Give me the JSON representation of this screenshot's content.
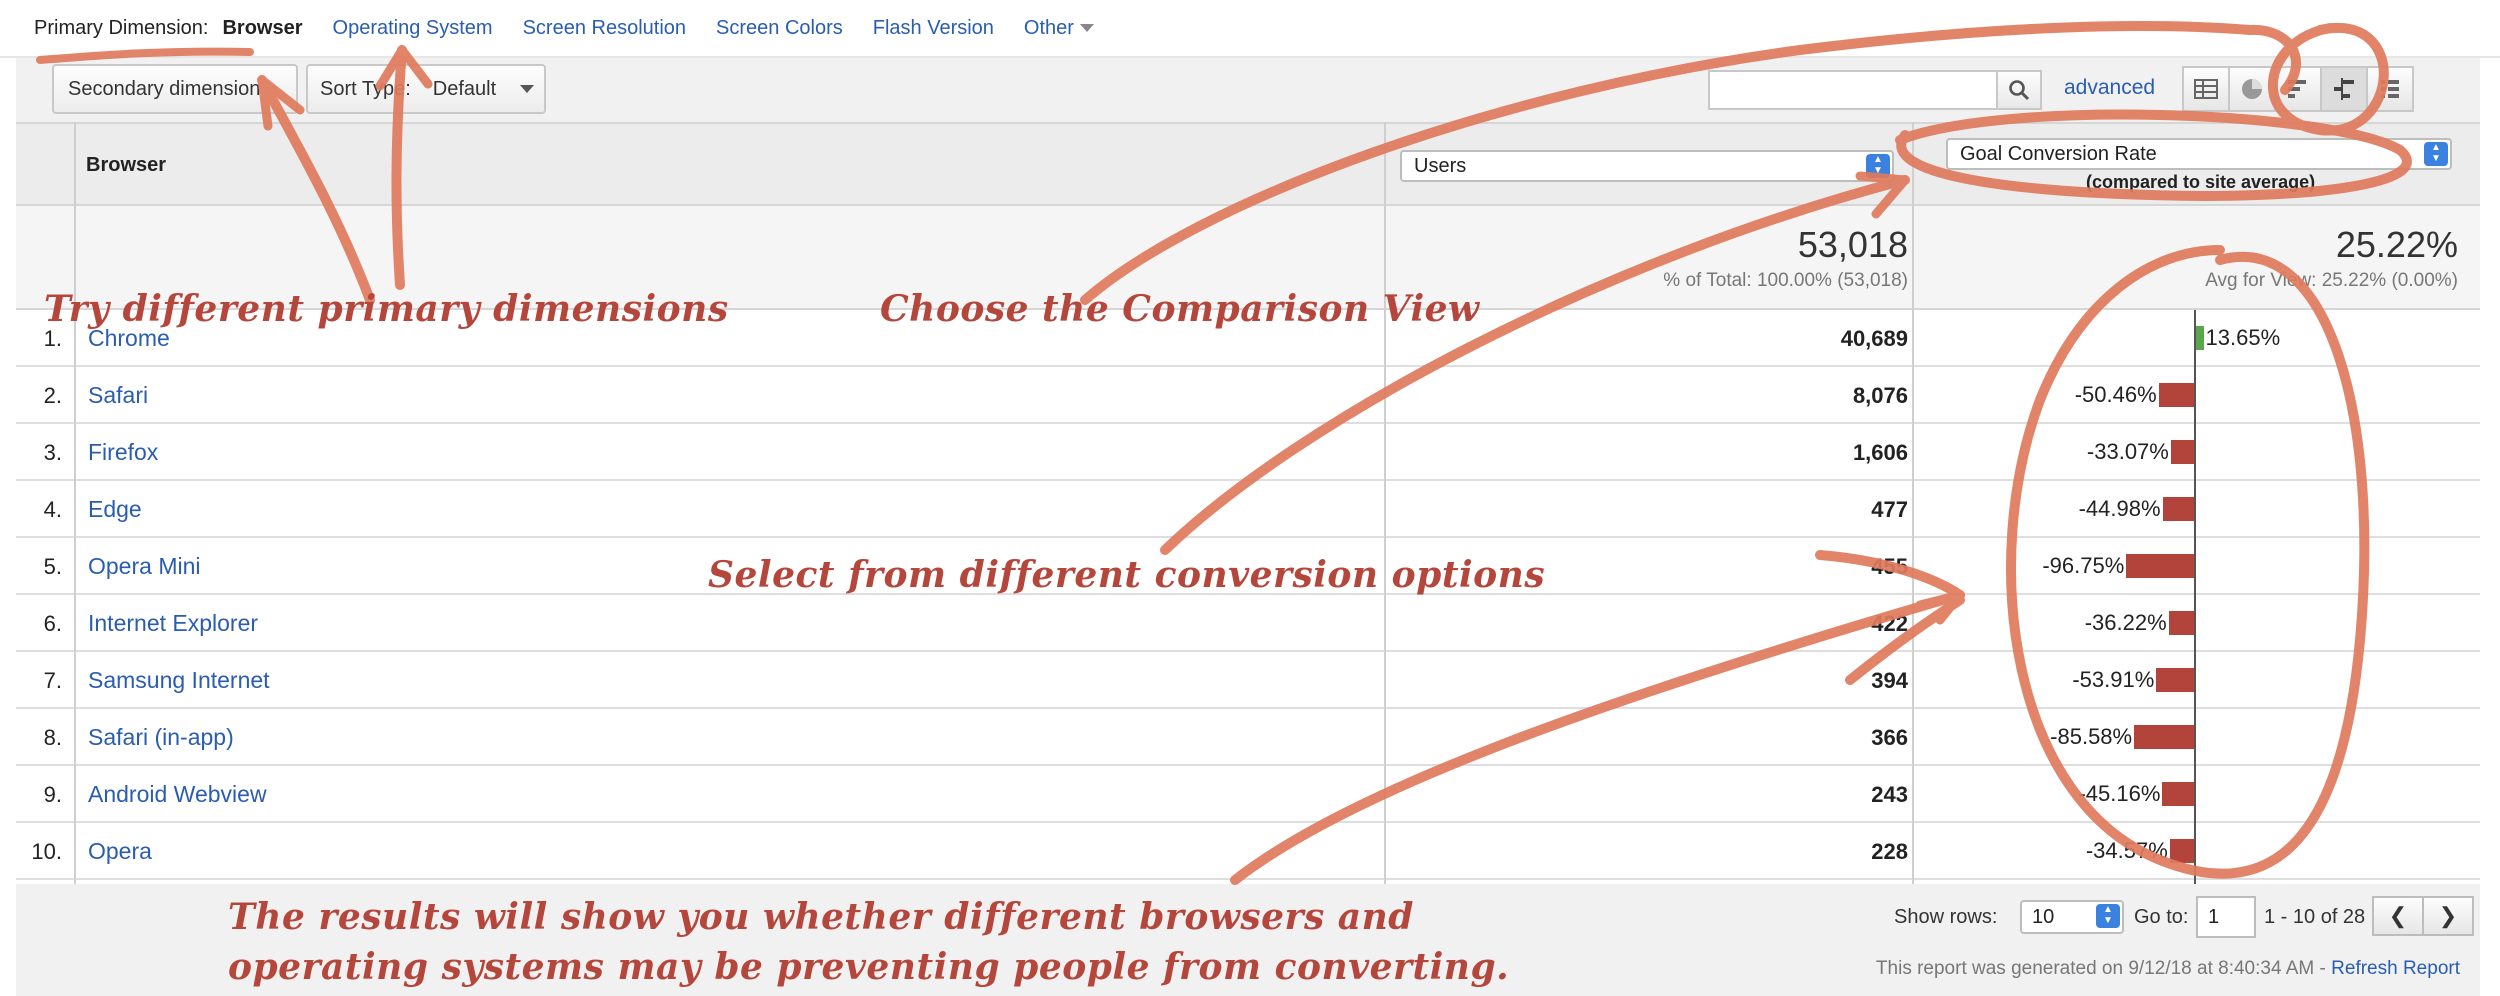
{
  "primary_dimension": {
    "label": "Primary Dimension:",
    "current": "Browser",
    "options": [
      "Operating System",
      "Screen Resolution",
      "Screen Colors",
      "Flash Version"
    ],
    "other": "Other"
  },
  "controls": {
    "secondary_dimension": "Secondary dimension",
    "sort_type_label": "Sort Type:",
    "sort_type_value": "Default",
    "search_placeholder": "",
    "advanced": "advanced"
  },
  "table": {
    "col_browser": "Browser",
    "metric_select": "Users",
    "comparison_select": "Goal Conversion Rate",
    "compared_note": "(compared to site average)",
    "totals": {
      "users": "53,018",
      "users_sub": "% of Total: 100.00% (53,018)",
      "goal": "25.22%",
      "goal_sub": "Avg for View: 25.22% (0.00%)"
    },
    "rows": [
      {
        "num": "1.",
        "name": "Chrome",
        "users": "40,689",
        "delta_label": "13.65%",
        "delta": 13.65
      },
      {
        "num": "2.",
        "name": "Safari",
        "users": "8,076",
        "delta_label": "-50.46%",
        "delta": -50.46
      },
      {
        "num": "3.",
        "name": "Firefox",
        "users": "1,606",
        "delta_label": "-33.07%",
        "delta": -33.07
      },
      {
        "num": "4.",
        "name": "Edge",
        "users": "477",
        "delta_label": "-44.98%",
        "delta": -44.98
      },
      {
        "num": "5.",
        "name": "Opera Mini",
        "users": "455",
        "delta_label": "-96.75%",
        "delta": -96.75
      },
      {
        "num": "6.",
        "name": "Internet Explorer",
        "users": "422",
        "delta_label": "-36.22%",
        "delta": -36.22
      },
      {
        "num": "7.",
        "name": "Samsung Internet",
        "users": "394",
        "delta_label": "-53.91%",
        "delta": -53.91
      },
      {
        "num": "8.",
        "name": "Safari (in-app)",
        "users": "366",
        "delta_label": "-85.58%",
        "delta": -85.58
      },
      {
        "num": "9.",
        "name": "Android Webview",
        "users": "243",
        "delta_label": "-45.16%",
        "delta": -45.16
      },
      {
        "num": "10.",
        "name": "Opera",
        "users": "228",
        "delta_label": "-34.57%",
        "delta": -34.57
      }
    ]
  },
  "footer": {
    "show_rows_label": "Show rows:",
    "show_rows_value": "10",
    "goto_label": "Go to:",
    "goto_value": "1",
    "range": "1 - 10 of 28",
    "generated": "This report was generated on 9/12/18 at 8:40:34 AM - ",
    "refresh": "Refresh Report"
  },
  "annotations": {
    "primary": "Try different primary dimensions",
    "comparison": "Choose the Comparison View",
    "conversion": "Select from different conversion options",
    "results_line1": "The results will show you whether different browsers and",
    "results_line2": "operating systems may be preventing people from converting."
  },
  "colors": {
    "positive_bar": "#5aa64a",
    "negative_bar": "#b2443b",
    "link": "#2a5db0",
    "annotation": "#b5463b",
    "pen_stroke": "#e07a5c"
  }
}
